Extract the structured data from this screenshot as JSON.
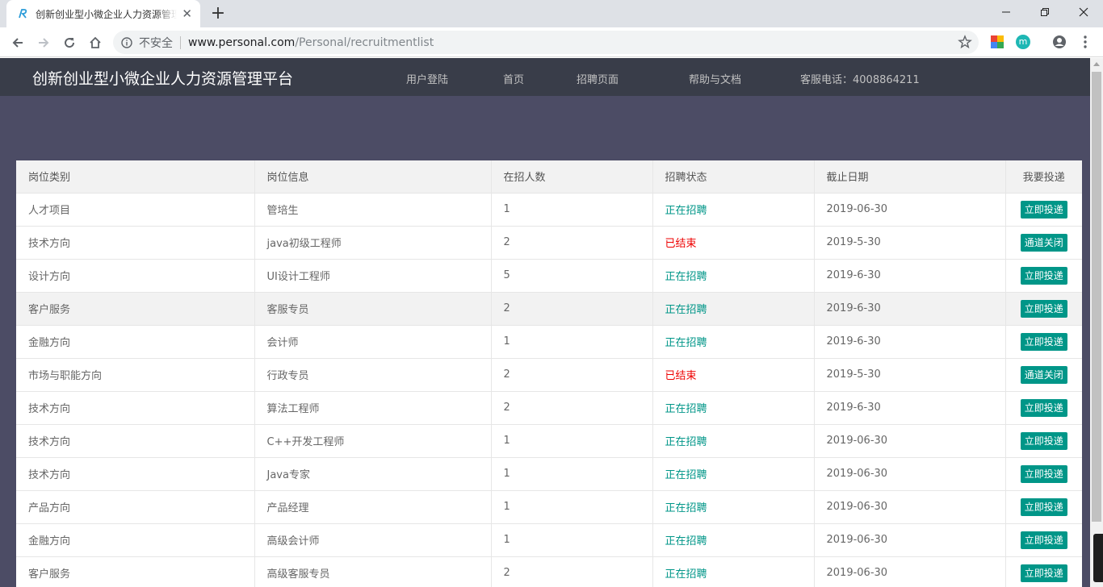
{
  "browser": {
    "tab_title": "创新创业型小微企业人力资源管理平台",
    "insecure_label": "不安全",
    "url_host": "www.personal.com",
    "url_path": "/Personal/recruitmentlist"
  },
  "site": {
    "title": "创新创业型小微企业人力资源管理平台",
    "nav": {
      "login": "用户登陆",
      "home": "首页",
      "recruit": "招聘页面",
      "help": "帮助与文档",
      "phone": "客服电话：4008864211"
    }
  },
  "table": {
    "headers": [
      "岗位类别",
      "岗位信息",
      "在招人数",
      "招聘状态",
      "截止日期",
      "我要投递"
    ],
    "rows": [
      {
        "category": "人才项目",
        "position": "管培生",
        "count": "1",
        "status": "正在招聘",
        "deadline": "2019-06-30",
        "action": "立即投递"
      },
      {
        "category": "技术方向",
        "position": "java初级工程师",
        "count": "2",
        "status": "已结束",
        "deadline": "2019-5-30",
        "action": "通道关闭"
      },
      {
        "category": "设计方向",
        "position": "UI设计工程师",
        "count": "5",
        "status": "正在招聘",
        "deadline": "2019-6-30",
        "action": "立即投递"
      },
      {
        "category": "客户服务",
        "position": "客服专员",
        "count": "2",
        "status": "正在招聘",
        "deadline": "2019-6-30",
        "action": "立即投递"
      },
      {
        "category": "金融方向",
        "position": "会计师",
        "count": "1",
        "status": "正在招聘",
        "deadline": "2019-6-30",
        "action": "立即投递"
      },
      {
        "category": "市场与职能方向",
        "position": "行政专员",
        "count": "2",
        "status": "已结束",
        "deadline": "2019-5-30",
        "action": "通道关闭"
      },
      {
        "category": "技术方向",
        "position": "算法工程师",
        "count": "2",
        "status": "正在招聘",
        "deadline": "2019-6-30",
        "action": "立即投递"
      },
      {
        "category": "技术方向",
        "position": "C++开发工程师",
        "count": "1",
        "status": "正在招聘",
        "deadline": "2019-06-30",
        "action": "立即投递"
      },
      {
        "category": "技术方向",
        "position": "Java专家",
        "count": "1",
        "status": "正在招聘",
        "deadline": "2019-06-30",
        "action": "立即投递"
      },
      {
        "category": "产品方向",
        "position": "产品经理",
        "count": "1",
        "status": "正在招聘",
        "deadline": "2019-06-30",
        "action": "立即投递"
      },
      {
        "category": "金融方向",
        "position": "高级会计师",
        "count": "1",
        "status": "正在招聘",
        "deadline": "2019-06-30",
        "action": "立即投递"
      },
      {
        "category": "客户服务",
        "position": "高级客服专员",
        "count": "2",
        "status": "正在招聘",
        "deadline": "2019-06-30",
        "action": "立即投递"
      }
    ]
  },
  "colors": {
    "header_bg": "#393d49",
    "page_bg": "#4c4c65",
    "accent": "#009688",
    "closed": "#ee0000"
  }
}
